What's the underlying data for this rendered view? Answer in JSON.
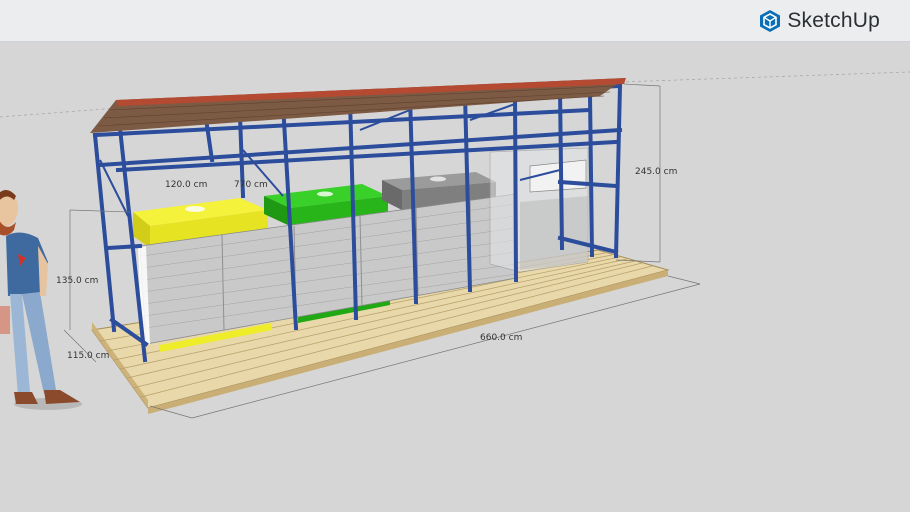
{
  "app": {
    "logo_text": "SketchUp",
    "logo_icon": "sketchup-logo-icon"
  },
  "dimensions": {
    "width_yellow_bin": "120.0 cm",
    "width_middle": "770 cm",
    "height_total": "245.0 cm",
    "height_front": "135.0 cm",
    "depth": "115.0 cm",
    "length": "660.0 cm"
  },
  "colors": {
    "frame": "#2f4fa0",
    "roof": "#a8523d",
    "yellow_bin": "#f2ef2e",
    "green_bin": "#2fc41e",
    "grey_bin": "#8c8c8c",
    "deck": "#e7d6a8"
  }
}
